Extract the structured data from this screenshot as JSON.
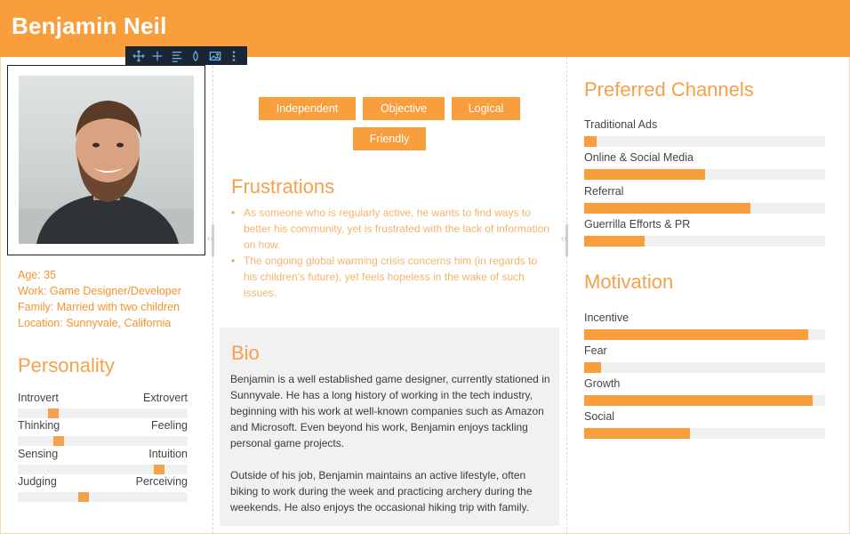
{
  "persona": {
    "name": "Benjamin Neil"
  },
  "colors": {
    "accent": "#f99e3c",
    "heading": "#f5a04b",
    "track": "#f0f0f0",
    "toolbar": "#1a2633"
  },
  "toolbar": {
    "icons": [
      "move-icon",
      "plus-icon",
      "align-icon",
      "drop-icon",
      "image-icon",
      "more-icon"
    ]
  },
  "facts": {
    "age": "Age: 35",
    "work": "Work: Game Designer/Developer",
    "family": "Family: Married with two children",
    "location": "Location: Sunnyvale, California"
  },
  "personality": {
    "title": "Personality",
    "traits": [
      {
        "left": "Introvert",
        "right": "Extrovert",
        "value": 0.21
      },
      {
        "left": "Thinking",
        "right": "Feeling",
        "value": 0.24
      },
      {
        "left": "Sensing",
        "right": "Intuition",
        "value": 0.83
      },
      {
        "left": "Judging",
        "right": "Perceiving",
        "value": 0.39
      }
    ]
  },
  "tags": [
    "Independent",
    "Objective",
    "Logical",
    "Friendly"
  ],
  "frustrations": {
    "title": "Frustrations",
    "items": [
      "As someone who is regularly active, he wants to find ways to better his community, yet is frustrated with the lack of information on how.",
      "The ongoing global warming crisis concerns him (in regards to his children's future), yet feels hopeless in the wake of such issues."
    ]
  },
  "bio": {
    "title": "Bio",
    "paragraphs": [
      "Benjamin is a well established game designer, currently stationed in Sunnyvale. He has a long history of working in the tech industry, beginning with his work at well-known companies such as Amazon and Microsoft. Even beyond his work, Benjamin enjoys tackling personal game projects.",
      "Outside of his job, Benjamin maintains an active lifestyle, often biking to work during the week and practicing archery during the weekends. He also enjoys the occasional hiking trip with family."
    ]
  },
  "channels": {
    "title": "Preferred Channels",
    "items": [
      {
        "label": "Traditional Ads",
        "value": 0.05
      },
      {
        "label": "Online & Social Media",
        "value": 0.5
      },
      {
        "label": "Referral",
        "value": 0.69
      },
      {
        "label": "Guerrilla Efforts & PR",
        "value": 0.25
      }
    ]
  },
  "motivation": {
    "title": "Motivation",
    "items": [
      {
        "label": "Incentive",
        "value": 0.93
      },
      {
        "label": "Fear",
        "value": 0.07
      },
      {
        "label": "Growth",
        "value": 0.95
      },
      {
        "label": "Social",
        "value": 0.44
      }
    ]
  }
}
